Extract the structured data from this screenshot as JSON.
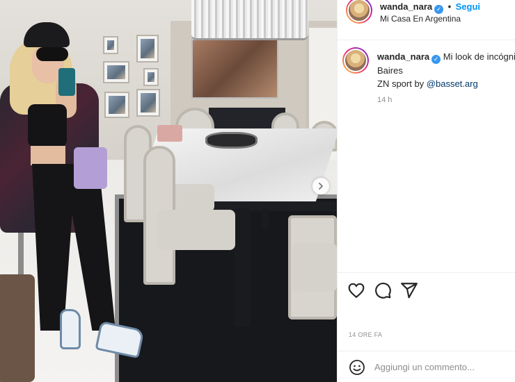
{
  "post": {
    "author": "wanda_nara",
    "follow_label": "Segui",
    "location": "Mi Casa En Argentina",
    "caption_text": "Mi look de incógnito por Buenos",
    "caption_line2": "Baires",
    "caption_line3_prefix": "ZN sport by ",
    "caption_mention": "@basset.arg",
    "relative_time": "14 h",
    "posted_time": "14 ORE FA"
  },
  "comment": {
    "placeholder": "Aggiungi un commento..."
  },
  "icons": {
    "verified": "verified-badge-icon",
    "like": "heart-icon",
    "comment": "comment-bubble-icon",
    "share": "paper-plane-icon",
    "emoji": "smiley-icon",
    "next": "chevron-right-icon"
  },
  "colors": {
    "link_blue": "#0095f6",
    "verified_blue": "#3897f0",
    "secondary_text": "#8e8e8e",
    "border": "#efefef"
  }
}
